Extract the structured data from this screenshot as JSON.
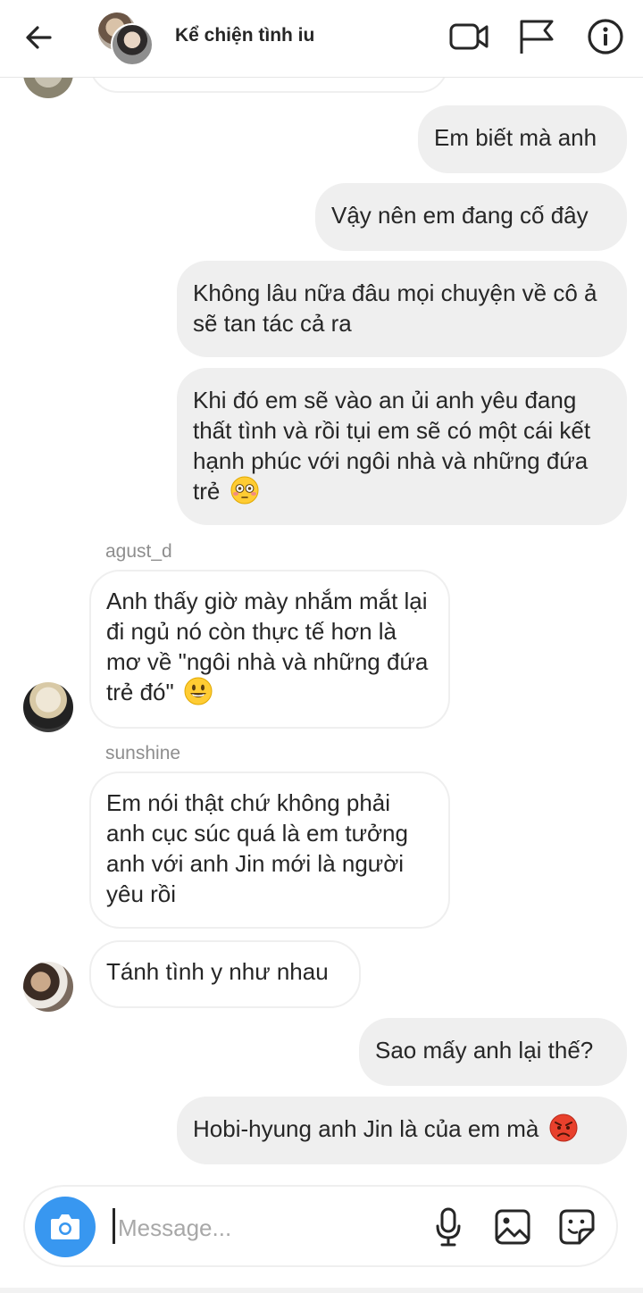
{
  "header": {
    "title": "Kể chiện tình iu",
    "icons": [
      "back-arrow-icon",
      "video-call-icon",
      "flag-icon",
      "info-icon"
    ]
  },
  "messages": [
    {
      "direction": "out",
      "text": "Em biết mà anh"
    },
    {
      "direction": "out",
      "text": "Vậy nên em đang cố đây"
    },
    {
      "direction": "out",
      "text": "Không lâu nữa đâu mọi chuyện về cô ả sẽ tan tác cả ra"
    },
    {
      "direction": "out",
      "text": "Khi đó em sẽ vào an ủi anh yêu đang thất tình và rồi tụi em sẽ có một cái kết hạnh phúc với ngôi nhà và những đứa trẻ",
      "emoji": "flushed-face"
    },
    {
      "direction": "in",
      "sender": "agust_d",
      "text": "Anh thấy giờ mày nhắm mắt lại đi ngủ nó còn thực tế hơn là mơ về \"ngôi nhà và những đứa trẻ đó\"",
      "emoji": "grinning-face"
    },
    {
      "direction": "in",
      "sender": "sunshine",
      "text": "Em nói thật chứ không phải anh cục súc quá là em tưởng anh với anh Jin mới là người yêu rồi"
    },
    {
      "direction": "in",
      "text": "Tánh tình y như nhau"
    },
    {
      "direction": "out",
      "text": "Sao mấy anh lại thế?"
    },
    {
      "direction": "out",
      "text": "Hobi-hyung anh Jin là của em mà",
      "emoji": "angry-face"
    }
  ],
  "composer": {
    "placeholder": "Message...",
    "icons": [
      "camera-icon",
      "microphone-icon",
      "gallery-icon",
      "sticker-icon"
    ]
  },
  "colors": {
    "outgoing_bubble": "#efefef",
    "incoming_border": "#efefef",
    "camera_button": "#3897f0",
    "text": "#262626",
    "secondary_text": "#8e8e8e"
  }
}
